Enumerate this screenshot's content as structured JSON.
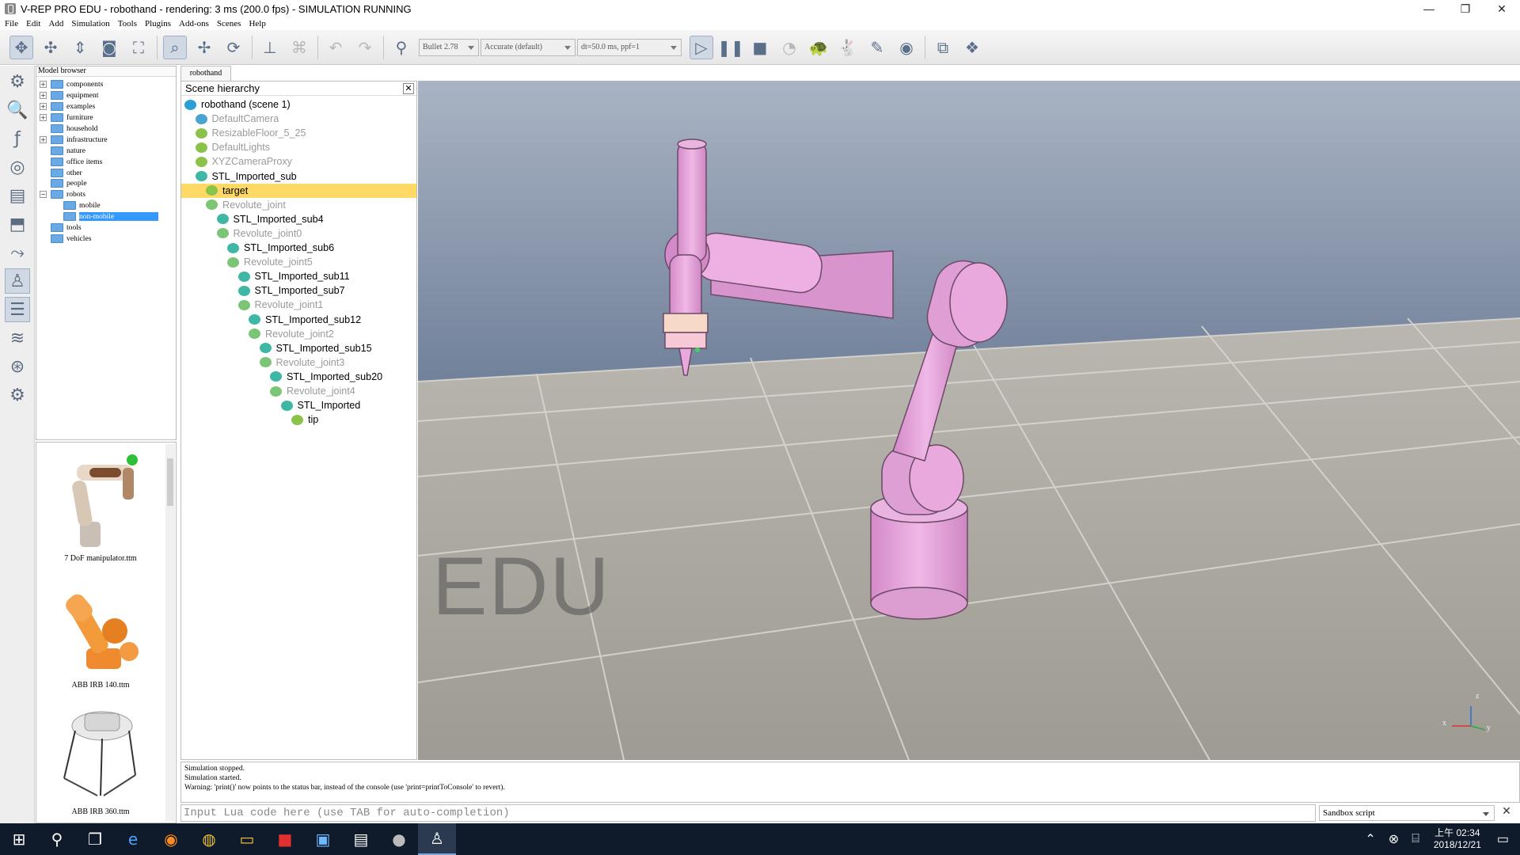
{
  "window": {
    "title": "V-REP PRO EDU - robothand - rendering: 3 ms (200.0 fps) - SIMULATION RUNNING",
    "min": "—",
    "max": "❐",
    "close": "✕"
  },
  "menu": [
    "File",
    "Edit",
    "Add",
    "Simulation",
    "Tools",
    "Plugins",
    "Add-ons",
    "Scenes",
    "Help"
  ],
  "toolbar": {
    "engine": "Bullet 2.78",
    "accuracy": "Accurate (default)",
    "timestep": "dt=50.0 ms, ppf=1",
    "icons": [
      "camera-pan-icon",
      "camera-rotate-icon",
      "camera-shift-icon",
      "camera-angle-icon",
      "fit-to-view-icon",
      "click-select-icon",
      "object-shift-icon",
      "object-rotate-icon",
      "assemble-icon",
      "transfer-dna-icon",
      "undo-icon",
      "redo-icon",
      "dynamics-icon",
      "play-icon",
      "pause-icon",
      "stop-icon",
      "real-time-icon",
      "slow-down-icon",
      "speed-up-icon",
      "threaded-rendering-icon",
      "visualization-icon",
      "scene-selector-icon",
      "page-selector-icon"
    ]
  },
  "left_tools": [
    "scene-object-properties-icon",
    "calculation-module-icon",
    "collections-icon",
    "scripts-icon",
    "shapes-icon",
    "path-icon",
    "selection-icon",
    "model-browser-icon",
    "scene-hierarchy-icon",
    "layers-icon",
    "video-recorder-icon",
    "user-settings-icon"
  ],
  "model_browser": {
    "header": "Model browser",
    "items": [
      {
        "label": "components",
        "level": 0,
        "exp": "+"
      },
      {
        "label": "equipment",
        "level": 0,
        "exp": "+"
      },
      {
        "label": "examples",
        "level": 0,
        "exp": "+"
      },
      {
        "label": "furniture",
        "level": 0,
        "exp": "+"
      },
      {
        "label": "household",
        "level": 0,
        "exp": ""
      },
      {
        "label": "infrastructure",
        "level": 0,
        "exp": "+"
      },
      {
        "label": "nature",
        "level": 0,
        "exp": ""
      },
      {
        "label": "office items",
        "level": 0,
        "exp": ""
      },
      {
        "label": "other",
        "level": 0,
        "exp": ""
      },
      {
        "label": "people",
        "level": 0,
        "exp": ""
      },
      {
        "label": "robots",
        "level": 0,
        "exp": "−"
      },
      {
        "label": "mobile",
        "level": 1,
        "exp": ""
      },
      {
        "label": "non-mobile",
        "level": 1,
        "exp": "",
        "selected": true
      },
      {
        "label": "tools",
        "level": 0,
        "exp": ""
      },
      {
        "label": "vehicles",
        "level": 0,
        "exp": ""
      }
    ],
    "thumbnails": [
      "7 DoF manipulator.ttm",
      "ABB IRB 140.ttm",
      "ABB IRB 360.ttm"
    ]
  },
  "scene_tab": "robothand",
  "hierarchy": {
    "header": "Scene hierarchy",
    "close": "✕",
    "rows": [
      {
        "label": "robothand (scene 1)",
        "level": 0,
        "grey": false,
        "icon": "scene-icon"
      },
      {
        "label": "DefaultCamera",
        "level": 1,
        "grey": true,
        "icon": "camera-icon"
      },
      {
        "label": "ResizableFloor_5_25",
        "level": 1,
        "grey": true,
        "icon": "dummy-icon"
      },
      {
        "label": "DefaultLights",
        "level": 1,
        "grey": true,
        "icon": "dummy-icon"
      },
      {
        "label": "XYZCameraProxy",
        "level": 1,
        "grey": true,
        "icon": "dummy-icon"
      },
      {
        "label": "STL_Imported_sub",
        "level": 1,
        "grey": false,
        "icon": "shape-icon"
      },
      {
        "label": "target",
        "level": 2,
        "grey": false,
        "icon": "dummy-icon",
        "selected": true
      },
      {
        "label": "Revolute_joint",
        "level": 2,
        "grey": true,
        "icon": "joint-icon"
      },
      {
        "label": "STL_Imported_sub4",
        "level": 3,
        "grey": false,
        "icon": "shape-icon"
      },
      {
        "label": "Revolute_joint0",
        "level": 3,
        "grey": true,
        "icon": "joint-icon"
      },
      {
        "label": "STL_Imported_sub6",
        "level": 4,
        "grey": false,
        "icon": "shape-icon"
      },
      {
        "label": "Revolute_joint5",
        "level": 4,
        "grey": true,
        "icon": "joint-icon"
      },
      {
        "label": "STL_Imported_sub11",
        "level": 5,
        "grey": false,
        "icon": "shape-icon"
      },
      {
        "label": "STL_Imported_sub7",
        "level": 5,
        "grey": false,
        "icon": "shape-icon"
      },
      {
        "label": "Revolute_joint1",
        "level": 5,
        "grey": true,
        "icon": "joint-icon"
      },
      {
        "label": "STL_Imported_sub12",
        "level": 6,
        "grey": false,
        "icon": "shape-icon"
      },
      {
        "label": "Revolute_joint2",
        "level": 6,
        "grey": true,
        "icon": "joint-icon"
      },
      {
        "label": "STL_Imported_sub15",
        "level": 7,
        "grey": false,
        "icon": "shape-icon"
      },
      {
        "label": "Revolute_joint3",
        "level": 7,
        "grey": true,
        "icon": "joint-icon"
      },
      {
        "label": "STL_Imported_sub20",
        "level": 8,
        "grey": false,
        "icon": "shape-icon"
      },
      {
        "label": "Revolute_joint4",
        "level": 8,
        "grey": true,
        "icon": "joint-icon"
      },
      {
        "label": "STL_Imported",
        "level": 9,
        "grey": false,
        "icon": "shape-icon"
      },
      {
        "label": "tip",
        "level": 10,
        "grey": false,
        "icon": "dummy-icon"
      }
    ]
  },
  "viewport": {
    "watermark": "EDU",
    "axis": {
      "x": "x",
      "y": "y",
      "z": "z"
    }
  },
  "console": [
    "Simulation stopped.",
    "Simulation started.",
    "Warning: 'print()' now points to the status bar, instead of the console (use 'print=printToConsole' to revert)."
  ],
  "lua_input": {
    "placeholder": "Input Lua code here (use TAB for auto-completion)"
  },
  "sandbox": {
    "label": "Sandbox script",
    "close": "✕"
  },
  "taskbar": {
    "apps": [
      "windows-start-icon",
      "search-icon",
      "task-view-icon",
      "edge-icon",
      "firefox-icon",
      "chrome-icon",
      "file-explorer-icon",
      "acrobat-icon",
      "remote-desktop-icon",
      "terminal-icon",
      "vrep-sphere-icon",
      "vrep-app-icon"
    ],
    "time": "上午 02:34",
    "date": "2018/12/21"
  },
  "colors": {
    "robot": "#e9a9dc",
    "selection": "#ffd966",
    "toolbar_active": "#cfd8e3",
    "taskbar": "#0f1a2a"
  }
}
